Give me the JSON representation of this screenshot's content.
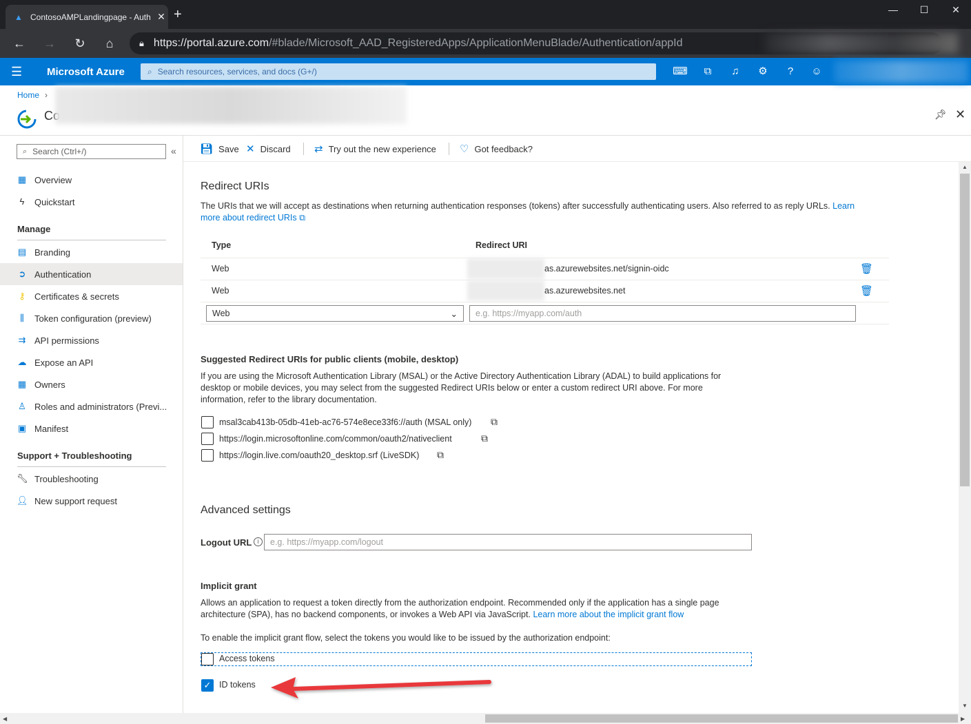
{
  "browser": {
    "tab_title": "ContosoAMPLandingpage - Auth",
    "url_host": "https://portal.azure.com",
    "url_path": "/#blade/Microsoft_AAD_RegisteredApps/ApplicationMenuBlade/Authentication/appId"
  },
  "azure": {
    "brand": "Microsoft Azure",
    "search_placeholder": "Search resources, services, and docs (G+/)"
  },
  "breadcrumb": {
    "home": "Home"
  },
  "app": {
    "title": "Co"
  },
  "sidebar": {
    "search_placeholder": "Search (Ctrl+/)",
    "items": [
      {
        "label": "Overview",
        "icon": "grid-icon"
      },
      {
        "label": "Quickstart",
        "icon": "lightning-icon"
      }
    ],
    "manage_header": "Manage",
    "manage_items": [
      {
        "label": "Branding",
        "icon": "branding-icon"
      },
      {
        "label": "Authentication",
        "icon": "authentication-icon"
      },
      {
        "label": "Certificates & secrets",
        "icon": "key-icon"
      },
      {
        "label": "Token configuration (preview)",
        "icon": "token-icon"
      },
      {
        "label": "API permissions",
        "icon": "api-permissions-icon"
      },
      {
        "label": "Expose an API",
        "icon": "cloud-icon"
      },
      {
        "label": "Owners",
        "icon": "owners-icon"
      },
      {
        "label": "Roles and administrators (Previ...",
        "icon": "roles-icon"
      },
      {
        "label": "Manifest",
        "icon": "manifest-icon"
      }
    ],
    "support_header": "Support + Troubleshooting",
    "support_items": [
      {
        "label": "Troubleshooting",
        "icon": "wrench-icon"
      },
      {
        "label": "New support request",
        "icon": "person-icon"
      }
    ]
  },
  "toolbar": {
    "save": "Save",
    "discard": "Discard",
    "try_new": "Try out the new experience",
    "feedback": "Got feedback?"
  },
  "redirect": {
    "title": "Redirect URIs",
    "desc_1": "The URIs that we will accept as destinations when returning authentication responses (tokens) after successfully authenticating users. Also referred to as reply URLs.",
    "link_1": "Learn",
    "link_2": "more about redirect URIs",
    "col_type": "Type",
    "col_uri": "Redirect URI",
    "rows": [
      {
        "type": "Web",
        "uri": "as.azurewebsites.net/signin-oidc"
      },
      {
        "type": "Web",
        "uri": "as.azurewebsites.net"
      }
    ],
    "new_type": "Web",
    "new_uri_placeholder": "e.g. https://myapp.com/auth"
  },
  "suggested": {
    "title": "Suggested Redirect URIs for public clients (mobile, desktop)",
    "desc_1": "If you are using the Microsoft Authentication Library (MSAL) or the Active Directory Authentication Library (ADAL) to build applications for",
    "desc_2": "desktop or mobile devices, you may select from the suggested Redirect URIs below or enter a custom redirect URI above. For more",
    "desc_3": "information, refer to the library documentation.",
    "uris": [
      "msal3cab413b-05db-41eb-ac76-574e8ece33f6://auth (MSAL only)",
      "https://login.microsoftonline.com/common/oauth2/nativeclient",
      "https://login.live.com/oauth20_desktop.srf (LiveSDK)"
    ]
  },
  "advanced": {
    "title": "Advanced settings",
    "logout_label": "Logout URL",
    "logout_placeholder": "e.g. https://myapp.com/logout"
  },
  "implicit": {
    "title": "Implicit grant",
    "desc_1": "Allows an application to request a token directly from the authorization endpoint. Recommended only if the application has a single page",
    "desc_2": "architecture (SPA), has no backend components, or invokes a Web API via JavaScript.",
    "link": "Learn more about the implicit grant flow",
    "instruction": "To enable the implicit grant flow, select the tokens you would like to be issued by the authorization endpoint:",
    "access_tokens": "Access tokens",
    "access_tokens_checked": false,
    "id_tokens": "ID tokens",
    "id_tokens_checked": true
  },
  "colors": {
    "accent": "#0078d4",
    "arrow": "#e8393a"
  }
}
